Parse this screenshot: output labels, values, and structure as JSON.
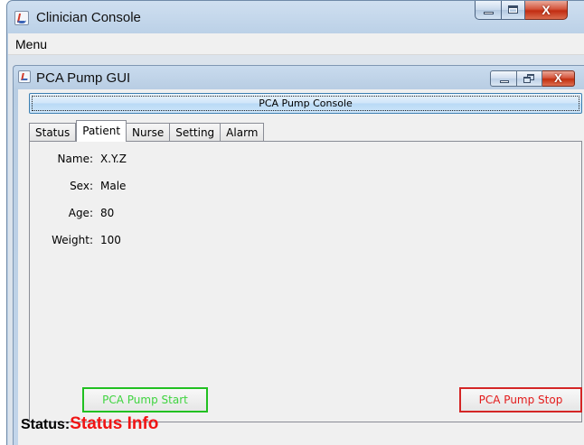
{
  "outer_window": {
    "title": "Clinician Console",
    "close_glyph": "X",
    "icon": "java-app-icon"
  },
  "menubar": {
    "items": [
      {
        "label": "Menu"
      }
    ]
  },
  "inner_window": {
    "title": "PCA Pump GUI",
    "close_glyph": "X",
    "icon": "java-app-icon"
  },
  "console_button": {
    "label": "PCA Pump Console"
  },
  "tabs": [
    {
      "label": "Status",
      "active": false
    },
    {
      "label": "Patient",
      "active": true
    },
    {
      "label": "Nurse",
      "active": false
    },
    {
      "label": "Setting",
      "active": false
    },
    {
      "label": "Alarm",
      "active": false
    }
  ],
  "patient": {
    "fields": [
      {
        "label": "Name:",
        "value": "X.Y.Z"
      },
      {
        "label": "Sex:",
        "value": "Male"
      },
      {
        "label": "Age:",
        "value": "80"
      },
      {
        "label": "Weight:",
        "value": "100"
      }
    ]
  },
  "controls": {
    "start_label": "PCA Pump Start",
    "stop_label": "PCA Pump Stop",
    "start_color": "#21c021",
    "stop_color": "#d42626"
  },
  "status": {
    "label": "Status:",
    "value": "Status Info",
    "value_color": "#f01414"
  }
}
